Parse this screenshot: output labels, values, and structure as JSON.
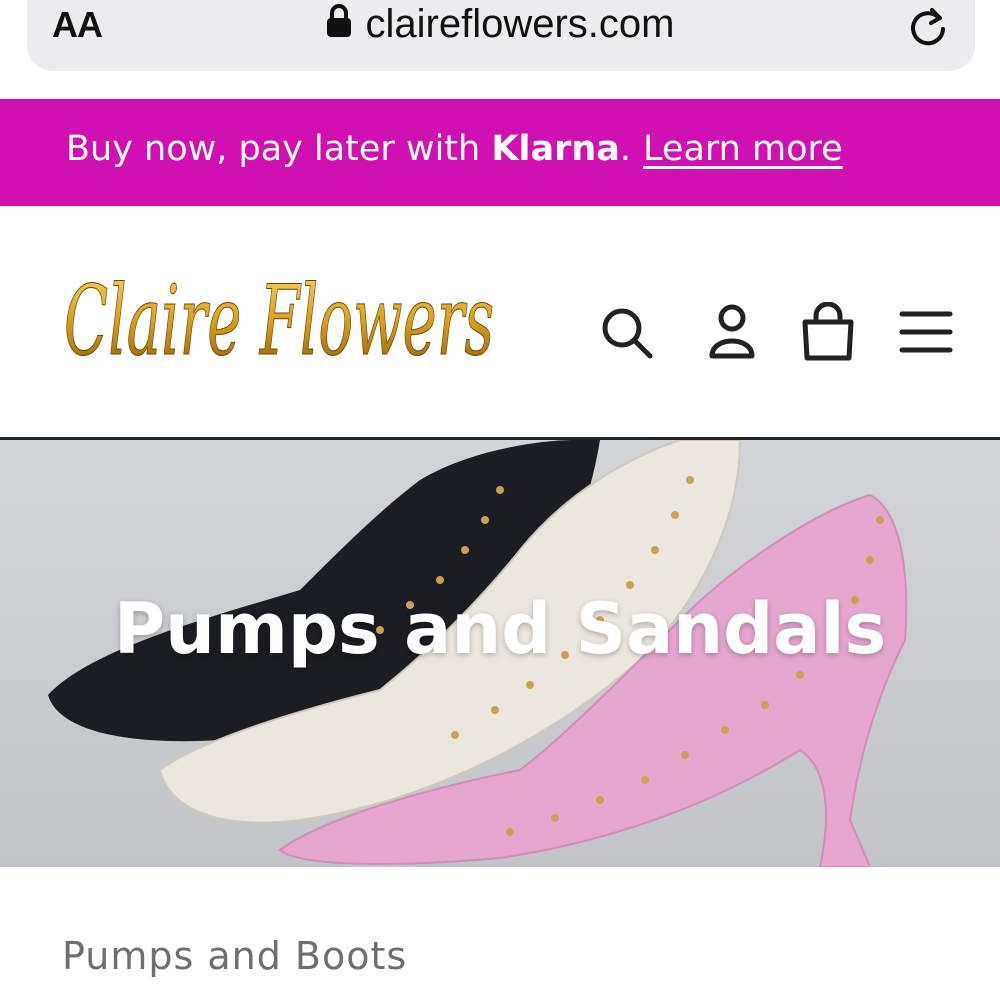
{
  "browser": {
    "text_size_label": "AA",
    "url": "claireflowers.com",
    "icons": [
      "lock-icon",
      "reload-icon"
    ]
  },
  "promo": {
    "text_before": "Buy now, pay later with ",
    "brand": "Klarna",
    "text_after": ".",
    "link_label": "Learn more",
    "background": "#d010b0"
  },
  "header": {
    "logo_text": "Claire Flowers",
    "icons": [
      "search-icon",
      "account-icon",
      "cart-icon",
      "menu-icon"
    ]
  },
  "hero": {
    "title": "Pumps and Sandals"
  },
  "collection": {
    "heading": "Pumps and Boots"
  }
}
